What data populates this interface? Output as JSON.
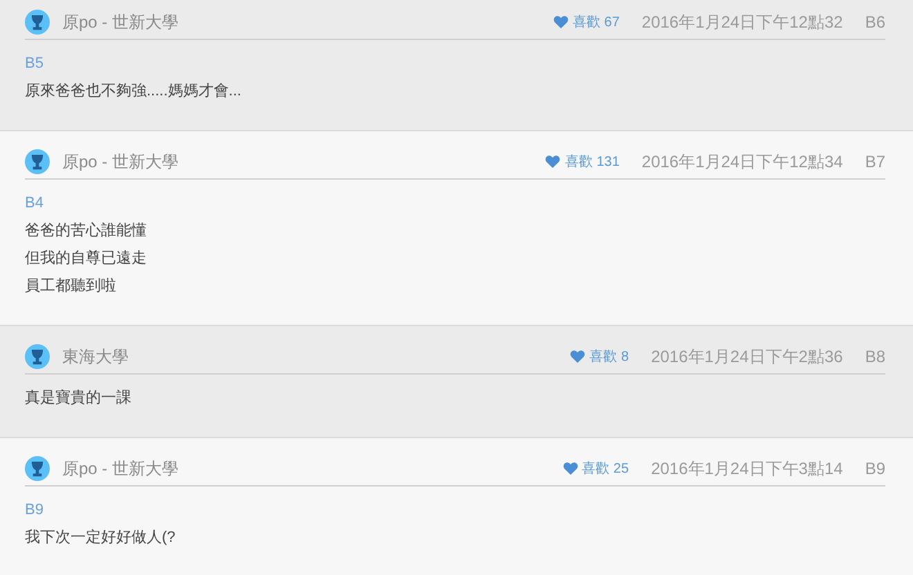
{
  "posts": [
    {
      "author": "原po - 世新大學",
      "likes": "喜歡 67",
      "date": "2016年1月24日下午12點32",
      "floor": "B6",
      "reply_to": "B5",
      "lines": [
        "原來爸爸也不夠強.....媽媽才會..."
      ]
    },
    {
      "author": "原po - 世新大學",
      "likes": "喜歡 131",
      "date": "2016年1月24日下午12點34",
      "floor": "B7",
      "reply_to": "B4",
      "lines": [
        "爸爸的苦心誰能懂",
        "但我的自尊已遠走",
        "員工都聽到啦"
      ]
    },
    {
      "author": "東海大學",
      "likes": "喜歡 8",
      "date": "2016年1月24日下午2點36",
      "floor": "B8",
      "lines": [
        "真是寶貴的一課"
      ]
    },
    {
      "author": "原po - 世新大學",
      "likes": "喜歡 25",
      "date": "2016年1月24日下午3點14",
      "floor": "B9",
      "reply_to": "B9",
      "lines": [
        "我下次一定好好做人(?"
      ]
    }
  ]
}
